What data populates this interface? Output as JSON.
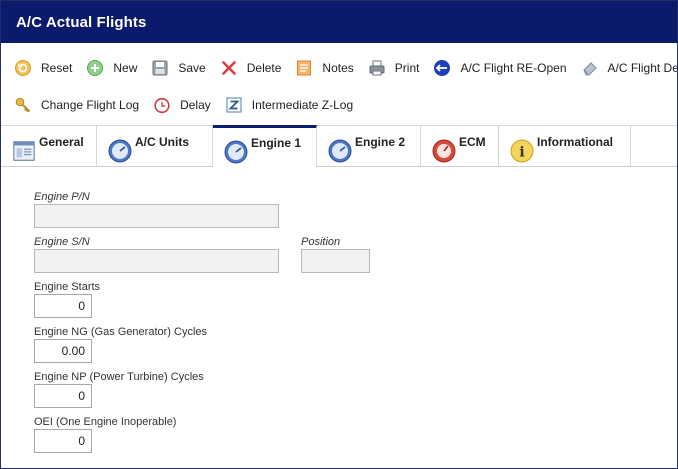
{
  "window": {
    "title": "A/C Actual Flights"
  },
  "toolbar": {
    "row1": [
      {
        "name": "reset-button",
        "icon": "reset-icon",
        "label": "Reset"
      },
      {
        "name": "new-button",
        "icon": "plus-circle-icon",
        "label": "New"
      },
      {
        "name": "save-button",
        "icon": "floppy-disk-icon",
        "label": "Save"
      },
      {
        "name": "delete-button",
        "icon": "red-x-icon",
        "label": "Delete"
      },
      {
        "name": "notes-button",
        "icon": "notepad-icon",
        "label": "Notes"
      },
      {
        "name": "print-button",
        "icon": "printer-icon",
        "label": "Print"
      },
      {
        "name": "flight-reopen-button",
        "icon": "reopen-arrows-icon",
        "label": "A/C Flight RE-Open"
      },
      {
        "name": "flight-delete-button",
        "icon": "eraser-icon",
        "label": "A/C Flight Delete"
      }
    ],
    "row2": [
      {
        "name": "change-flight-log-button",
        "icon": "key-icon",
        "label": "Change Flight Log"
      },
      {
        "name": "delay-button",
        "icon": "clock-icon",
        "label": "Delay"
      },
      {
        "name": "intermediate-zlog-button",
        "icon": "z-log-icon",
        "label": "Intermediate Z-Log"
      }
    ]
  },
  "tabs": [
    {
      "name": "tab-general",
      "icon": "form-icon",
      "label": "General",
      "active": false
    },
    {
      "name": "tab-ac-units",
      "icon": "gauge-icon",
      "label": "A/C Units",
      "active": false
    },
    {
      "name": "tab-engine-1",
      "icon": "gauge-icon",
      "label": "Engine 1",
      "active": true
    },
    {
      "name": "tab-engine-2",
      "icon": "gauge-icon",
      "label": "Engine 2",
      "active": false
    },
    {
      "name": "tab-ecm",
      "icon": "red-gauge-icon",
      "label": "ECM",
      "active": false
    },
    {
      "name": "tab-informational",
      "icon": "info-icon",
      "label": "Informational",
      "active": false
    }
  ],
  "form": {
    "engine_pn": {
      "label": "Engine P/N",
      "value": ""
    },
    "engine_sn": {
      "label": "Engine S/N",
      "value": ""
    },
    "position": {
      "label": "Position",
      "value": ""
    },
    "engine_starts": {
      "label": "Engine Starts",
      "value": "0"
    },
    "ng_cycles": {
      "label": "Engine NG (Gas Generator) Cycles",
      "value": "0.00"
    },
    "np_cycles": {
      "label": "Engine NP (Power Turbine) Cycles",
      "value": "0"
    },
    "oei": {
      "label": "OEI (One Engine Inoperable)",
      "value": "0"
    }
  },
  "colors": {
    "titlebar": "#0b1a6b",
    "active_tab_border": "#0b1a6b",
    "field_bg": "#f2f2f2"
  }
}
